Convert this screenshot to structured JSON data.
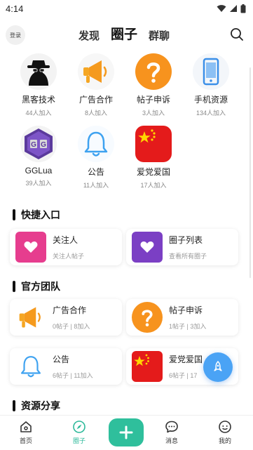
{
  "status": {
    "time": "4:14"
  },
  "header": {
    "login_label": "登录",
    "tabs": [
      {
        "label": "发现",
        "active": false
      },
      {
        "label": "圈子",
        "active": true
      },
      {
        "label": "群聊",
        "active": false
      }
    ]
  },
  "circles": [
    {
      "name": "黑客技术",
      "count": "44人加入",
      "icon": "hacker-icon"
    },
    {
      "name": "广告合作",
      "count": "8人加入",
      "icon": "megaphone-icon"
    },
    {
      "name": "帖子申诉",
      "count": "3人加入",
      "icon": "question-icon"
    },
    {
      "name": "手机资源",
      "count": "134人加入",
      "icon": "phone-icon"
    },
    {
      "name": "GGLua",
      "count": "39人加入",
      "icon": "gg-icon"
    },
    {
      "name": "公告",
      "count": "11人加入",
      "icon": "bell-icon"
    },
    {
      "name": "爱党爱国",
      "count": "17人加入",
      "icon": "china-flag-icon"
    }
  ],
  "sections": {
    "quick_entry": {
      "title": "快捷入口",
      "cards": [
        {
          "title": "关注人",
          "sub": "关注人帖子",
          "color": "#e63d8e",
          "icon": "heart-icon"
        },
        {
          "title": "圈子列表",
          "sub": "查看所有圈子",
          "color": "#7b3fc4",
          "icon": "heart-icon"
        }
      ]
    },
    "official_team": {
      "title": "官方团队",
      "cards": [
        {
          "title": "广告合作",
          "sub": "0帖子 | 8加入",
          "icon": "megaphone-icon"
        },
        {
          "title": "帖子申诉",
          "sub": "1帖子 | 3加入",
          "icon": "question-icon"
        },
        {
          "title": "公告",
          "sub": "6帖子 | 11加入",
          "icon": "bell-icon"
        },
        {
          "title": "爱党爱国",
          "sub": "6帖子 | 17",
          "icon": "china-flag-icon"
        }
      ]
    },
    "resources": {
      "title": "资源分享"
    }
  },
  "bottom_nav": {
    "items": [
      {
        "label": "首页",
        "icon": "home-icon",
        "active": false
      },
      {
        "label": "圈子",
        "icon": "compass-icon",
        "active": true
      },
      {
        "label": "",
        "icon": "plus-icon",
        "active": false
      },
      {
        "label": "消息",
        "icon": "message-icon",
        "active": false
      },
      {
        "label": "我的",
        "icon": "profile-icon",
        "active": false
      }
    ]
  },
  "colors": {
    "accent": "#2fbf9c",
    "orange": "#f59a1e",
    "blue": "#3ea2f0",
    "red": "#e41b1b"
  }
}
